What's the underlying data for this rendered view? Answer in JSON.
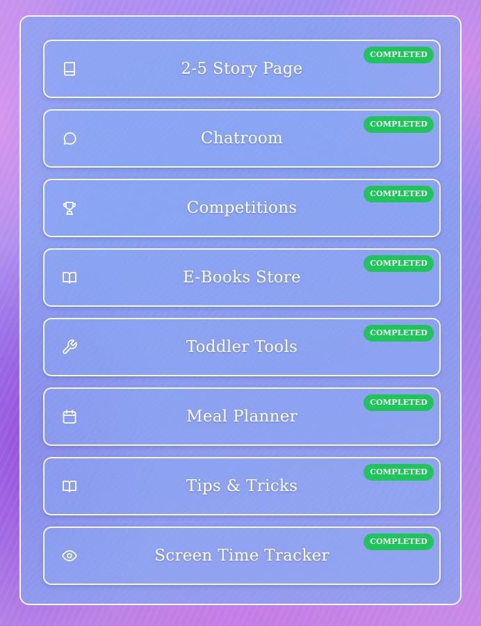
{
  "status_colors": {
    "completed": "#1fc45b"
  },
  "items": [
    {
      "label": "2-5 Story Page",
      "icon": "book-icon",
      "status": "COMPLETED"
    },
    {
      "label": "Chatroom",
      "icon": "message-circle-icon",
      "status": "COMPLETED"
    },
    {
      "label": "Competitions",
      "icon": "trophy-icon",
      "status": "COMPLETED"
    },
    {
      "label": "E-Books Store",
      "icon": "open-book-icon",
      "status": "COMPLETED"
    },
    {
      "label": "Toddler Tools",
      "icon": "wrench-icon",
      "status": "COMPLETED"
    },
    {
      "label": "Meal Planner",
      "icon": "calendar-icon",
      "status": "COMPLETED"
    },
    {
      "label": "Tips & Tricks",
      "icon": "open-book-icon",
      "status": "COMPLETED"
    },
    {
      "label": "Screen Time Tracker",
      "icon": "eye-icon",
      "status": "COMPLETED"
    }
  ]
}
